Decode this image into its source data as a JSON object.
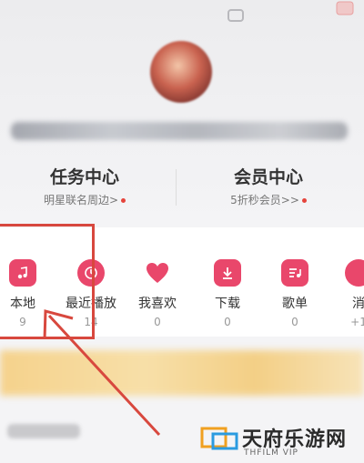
{
  "header": {
    "icons": [
      "chat-icon",
      "settings-icon"
    ]
  },
  "profile": {
    "avatar": "avatar"
  },
  "cards": [
    {
      "title": "任务中心",
      "sub": "明星联名周边>"
    },
    {
      "title": "会员中心",
      "sub": "5折秒会员>>"
    }
  ],
  "quick_access": [
    {
      "label": "本地",
      "count": "9",
      "icon": "music-note-icon"
    },
    {
      "label": "最近播放",
      "count": "14",
      "icon": "clock-icon"
    },
    {
      "label": "我喜欢",
      "count": "0",
      "icon": "heart-icon"
    },
    {
      "label": "下载",
      "count": "0",
      "icon": "download-icon"
    },
    {
      "label": "歌单",
      "count": "0",
      "icon": "playlist-icon"
    },
    {
      "label": "消",
      "count": "+1",
      "icon": "message-icon"
    }
  ],
  "watermark": {
    "title": "天府乐游网",
    "sub": "THFILM VIP"
  },
  "colors": {
    "accent": "#e9476b",
    "highlight": "#d8483e",
    "dot": "#e5433b"
  }
}
